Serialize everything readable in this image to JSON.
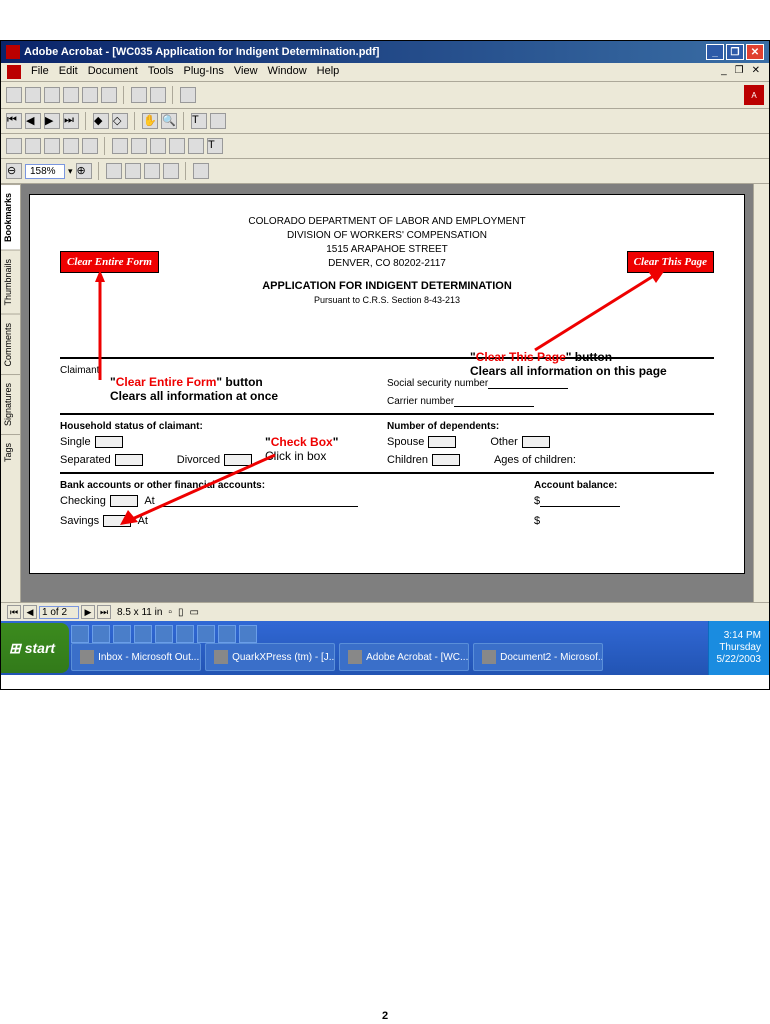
{
  "titlebar": {
    "text": "Adobe Acrobat - [WC035 Application for Indigent Determination.pdf]"
  },
  "menubar": {
    "items": [
      "File",
      "Edit",
      "Document",
      "Tools",
      "Plug-Ins",
      "View",
      "Window",
      "Help"
    ]
  },
  "zoom": "158%",
  "adobe": "A",
  "sidebar": {
    "tabs": [
      "Bookmarks",
      "Thumbnails",
      "Comments",
      "Signatures",
      "Tags"
    ]
  },
  "form": {
    "header1": "COLORADO DEPARTMENT OF LABOR AND EMPLOYMENT",
    "header2": "DIVISION OF WORKERS' COMPENSATION",
    "header3": "1515 ARAPAHOE STREET",
    "header4": "DENVER, CO 80202-2117",
    "title": "APPLICATION FOR INDIGENT DETERMINATION",
    "subtitle": "Pursuant to C.R.S. Section 8-43-213",
    "btn_clear_form": "Clear Entire Form",
    "btn_clear_page": "Clear This Page",
    "claimant_label": "Claimant",
    "ssn_label": "Social security number",
    "carrier_label": "Carrier number",
    "household_title": "Household status of claimant:",
    "dependents_title": "Number of dependents:",
    "single": "Single",
    "separated": "Separated",
    "divorced": "Divorced",
    "spouse": "Spouse",
    "children": "Children",
    "other": "Other",
    "ages": "Ages of children:",
    "bank_title": "Bank accounts or other financial accounts:",
    "balance_title": "Account balance:",
    "checking": "Checking",
    "savings": "Savings",
    "at": "At",
    "dollar": "$"
  },
  "annotations": {
    "clear_form_red": "Clear Entire Form",
    "clear_form_suffix": "\" button",
    "clear_form_desc": "Clears all information at once",
    "clear_page_red": "Clear This Page",
    "clear_page_suffix": "\" button",
    "clear_page_desc": "Clears all information on this page",
    "checkbox_red": "Check Box",
    "checkbox_desc": "Click in box"
  },
  "statusbar": {
    "page": "1 of 2",
    "size": "8.5 x 11 in"
  },
  "taskbar": {
    "start": "start",
    "items": [
      "Inbox - Microsoft Out...",
      "QuarkXPress (tm) - [J...",
      "Adobe Acrobat - [WC...",
      "Document2 - Microsof..."
    ],
    "time": "3:14 PM",
    "day": "Thursday",
    "date": "5/22/2003"
  },
  "page_number": "2"
}
